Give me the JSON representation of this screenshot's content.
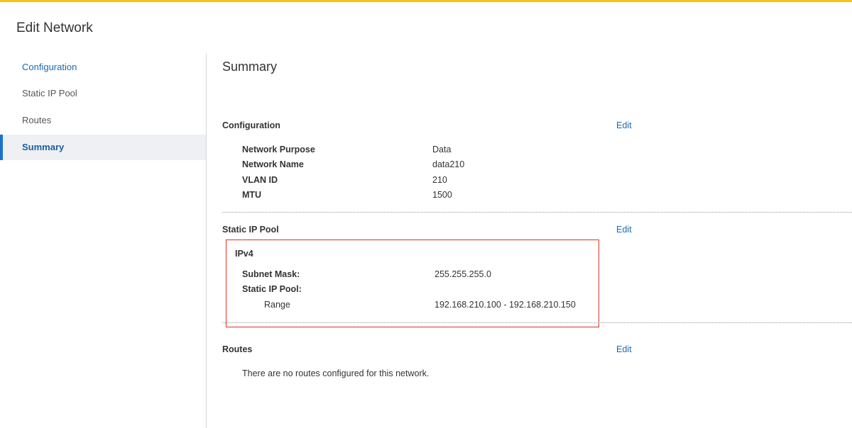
{
  "page": {
    "title": "Edit Network"
  },
  "colors": {
    "accent_bar": "#f5c518",
    "link": "#1a6bb0",
    "active_indicator": "#1b73c9",
    "highlight_box": "#e0302a"
  },
  "sidebar": {
    "items": [
      {
        "label": "Configuration",
        "state": "link"
      },
      {
        "label": "Static IP Pool",
        "state": "normal"
      },
      {
        "label": "Routes",
        "state": "normal"
      },
      {
        "label": "Summary",
        "state": "active"
      }
    ]
  },
  "main": {
    "title": "Summary",
    "configuration": {
      "heading": "Configuration",
      "edit_label": "Edit",
      "rows": [
        {
          "key": "Network Purpose",
          "value": "Data"
        },
        {
          "key": "Network Name",
          "value": "data210"
        },
        {
          "key": "VLAN ID",
          "value": "210"
        },
        {
          "key": "MTU",
          "value": "1500"
        }
      ]
    },
    "static_ip_pool": {
      "heading": "Static IP Pool",
      "edit_label": "Edit",
      "ip_version": "IPv4",
      "subnet_mask_label": "Subnet Mask:",
      "subnet_mask_value": "255.255.255.0",
      "pool_label": "Static IP Pool:",
      "range_label": "Range",
      "range_value": "192.168.210.100 - 192.168.210.150"
    },
    "routes": {
      "heading": "Routes",
      "edit_label": "Edit",
      "empty_message": "There are no routes configured for this network."
    }
  }
}
